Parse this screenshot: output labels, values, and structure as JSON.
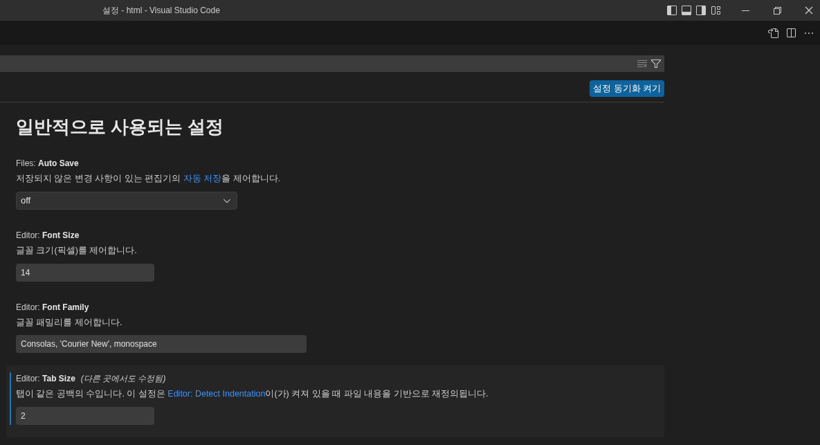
{
  "window": {
    "title": "설정 - html - Visual Studio Code"
  },
  "sync_button": "설정 동기화 켜기",
  "section_title": "일반적으로 사용되는 설정",
  "settings": [
    {
      "kind": "select",
      "category": "Files: ",
      "name": "Auto Save",
      "desc_before": "저장되지 않은 변경 사항이 있는 편집기의 ",
      "link": "자동 저장",
      "desc_after": "을 제어합니다.",
      "value": "off",
      "selected": false
    },
    {
      "kind": "input",
      "category": "Editor: ",
      "name": "Font Size",
      "desc_before": "글꼴 크기(픽셀)를 제어합니다.",
      "value": "14",
      "wide": false,
      "selected": false
    },
    {
      "kind": "input",
      "category": "Editor: ",
      "name": "Font Family",
      "desc_before": "글꼴 패밀리를 제어합니다.",
      "value": "Consolas, 'Courier New', monospace",
      "wide": true,
      "selected": false
    },
    {
      "kind": "input",
      "category": "Editor: ",
      "name": "Tab Size",
      "modified_note": "(다른 곳에서도 수정됨)",
      "desc_before": "탭이 같은 공백의 수입니다. 이 설정은 ",
      "link": "Editor: Detect Indentation",
      "desc_after": "이(가) 켜져 있을 때 파일 내용을 기반으로 재정의됩니다.",
      "value": "2",
      "wide": false,
      "selected": true
    }
  ]
}
